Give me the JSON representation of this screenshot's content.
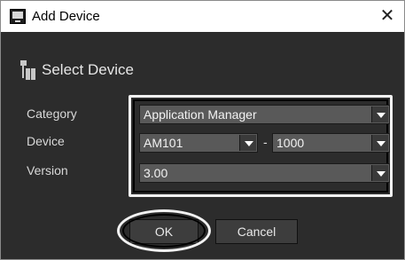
{
  "window": {
    "title": "Add Device",
    "close_glyph": "✕"
  },
  "section": {
    "title": "Select Device",
    "icon": "device-tree-icon"
  },
  "form": {
    "category_label": "Category",
    "device_label": "Device",
    "version_label": "Version",
    "category_value": "Application Manager",
    "device_value": "AM101",
    "device_dash": "-",
    "model_value": "1000",
    "version_value": "3.00"
  },
  "buttons": {
    "ok": "OK",
    "cancel": "Cancel"
  },
  "colors": {
    "dialog_bg": "#2c2c2c",
    "dropdown_bg": "#595959",
    "highlight": "#f2f2f2"
  }
}
